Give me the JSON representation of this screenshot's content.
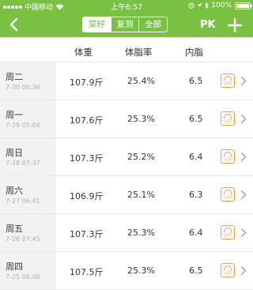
{
  "status_bar": {
    "carrier": "中国移动",
    "time": "上午6:57",
    "battery": "100%"
  },
  "nav": {
    "segments": [
      {
        "label": "菜籽",
        "active": true
      },
      {
        "label": "复测",
        "active": false
      },
      {
        "label": "全部",
        "active": false
      }
    ],
    "pk_label": "PK"
  },
  "table": {
    "headers": {
      "weight": "体重",
      "fat": "体脂率",
      "visceral": "内脂"
    },
    "rows": [
      {
        "day": "周二",
        "date": "7-30 06:36",
        "weight": "107.9斤",
        "fat": "25.4%",
        "visceral": "6.5"
      },
      {
        "day": "周一",
        "date": "7-29 05:04",
        "weight": "107.6斤",
        "fat": "25.3%",
        "visceral": "6.5"
      },
      {
        "day": "周日",
        "date": "7-28 07:37",
        "weight": "107.3斤",
        "fat": "25.2%",
        "visceral": "6.4"
      },
      {
        "day": "周六",
        "date": "7-27 06:41",
        "weight": "106.9斤",
        "fat": "25.1%",
        "visceral": "6.3"
      },
      {
        "day": "周五",
        "date": "7-26 07:45",
        "weight": "107.3斤",
        "fat": "25.3%",
        "visceral": "6.4"
      },
      {
        "day": "周四",
        "date": "7-25 06:06",
        "weight": "107.5斤",
        "fat": "25.3%",
        "visceral": "6.5"
      }
    ],
    "report_icon_text": "LUTE"
  }
}
